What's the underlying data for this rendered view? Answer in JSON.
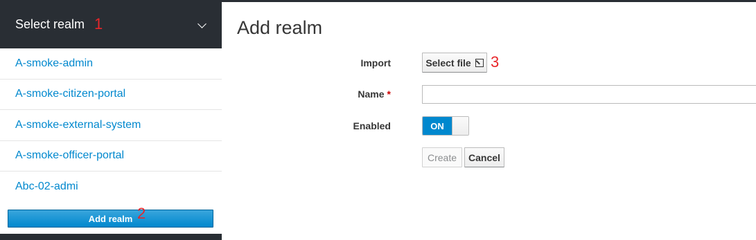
{
  "sidebar": {
    "realm_selector": {
      "label": "Select realm",
      "annotation": "1"
    },
    "realms": [
      {
        "label": "A-smoke-admin"
      },
      {
        "label": "A-smoke-citizen-portal"
      },
      {
        "label": "A-smoke-external-system"
      },
      {
        "label": "A-smoke-officer-portal"
      },
      {
        "label": "Abc-02-admi"
      }
    ],
    "add_realm_label": "Add realm",
    "add_realm_annotation": "2"
  },
  "main": {
    "title": "Add realm",
    "import": {
      "label": "Import",
      "button_label": "Select file",
      "annotation": "3"
    },
    "name": {
      "label": "Name",
      "required_marker": "*",
      "value": ""
    },
    "enabled": {
      "label": "Enabled",
      "toggle_text": "ON",
      "state": true
    },
    "actions": {
      "create_label": "Create",
      "cancel_label": "Cancel"
    }
  },
  "colors": {
    "header_bg": "#292e34",
    "link": "#0088ce",
    "primary": "#0088ce",
    "annotation": "#e8262a"
  }
}
